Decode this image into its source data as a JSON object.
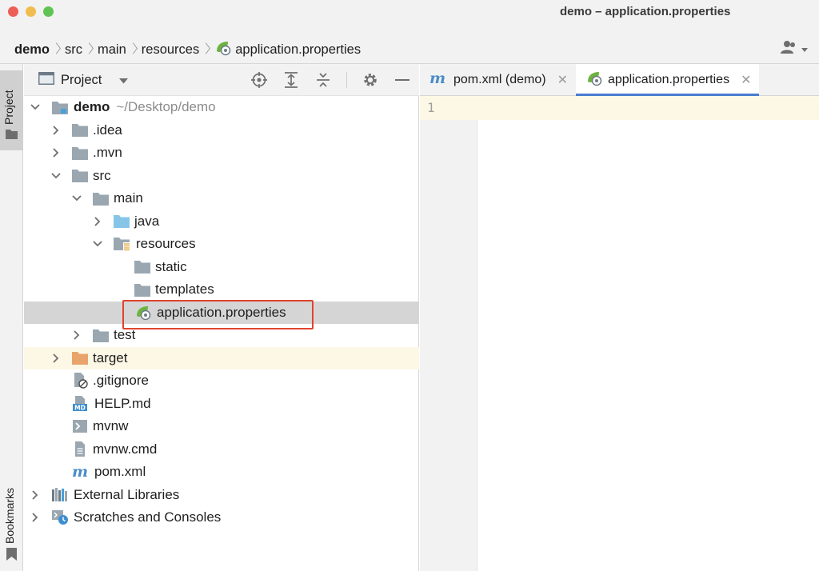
{
  "window": {
    "title": "demo – application.properties"
  },
  "breadcrumbs": [
    {
      "label": "demo",
      "bold": true
    },
    {
      "label": "src"
    },
    {
      "label": "main"
    },
    {
      "label": "resources"
    },
    {
      "label": "application.properties",
      "icon": "spring-properties-icon"
    }
  ],
  "project_panel": {
    "title": "Project",
    "tools": [
      "locate-icon",
      "expand-all-icon",
      "collapse-all-icon",
      "gear-icon",
      "hide-icon"
    ]
  },
  "tree": [
    {
      "label": "demo",
      "hint": "~/Desktop/demo",
      "depth": 0,
      "state": "expanded",
      "icon": "module-folder-icon",
      "bold": true
    },
    {
      "label": ".idea",
      "depth": 1,
      "state": "collapsed",
      "icon": "folder-icon"
    },
    {
      "label": ".mvn",
      "depth": 1,
      "state": "collapsed",
      "icon": "folder-icon"
    },
    {
      "label": "src",
      "depth": 1,
      "state": "expanded",
      "icon": "folder-icon"
    },
    {
      "label": "main",
      "depth": 2,
      "state": "expanded",
      "icon": "folder-icon"
    },
    {
      "label": "java",
      "depth": 3,
      "state": "collapsed",
      "icon": "source-folder-icon"
    },
    {
      "label": "resources",
      "depth": 3,
      "state": "expanded",
      "icon": "resources-folder-icon"
    },
    {
      "label": "static",
      "depth": 4,
      "state": "none",
      "icon": "folder-icon"
    },
    {
      "label": "templates",
      "depth": 4,
      "state": "none",
      "icon": "folder-icon"
    },
    {
      "label": "application.properties",
      "depth": 4,
      "state": "none",
      "icon": "spring-properties-icon",
      "selected": true,
      "highlighted": true
    },
    {
      "label": "test",
      "depth": 2,
      "state": "collapsed",
      "icon": "folder-icon"
    },
    {
      "label": "target",
      "depth": 1,
      "state": "collapsed",
      "icon": "excluded-folder-icon",
      "excluded": true
    },
    {
      "label": ".gitignore",
      "depth": 1,
      "state": "none",
      "icon": "ignore-file-icon"
    },
    {
      "label": "HELP.md",
      "depth": 1,
      "state": "none",
      "icon": "markdown-file-icon"
    },
    {
      "label": "mvnw",
      "depth": 1,
      "state": "none",
      "icon": "shell-script-icon"
    },
    {
      "label": "mvnw.cmd",
      "depth": 1,
      "state": "none",
      "icon": "text-file-icon"
    },
    {
      "label": "pom.xml",
      "depth": 1,
      "state": "none",
      "icon": "maven-icon"
    },
    {
      "label": "External Libraries",
      "depth": 0,
      "state": "collapsed",
      "icon": "libraries-icon"
    },
    {
      "label": "Scratches and Consoles",
      "depth": 0,
      "state": "collapsed",
      "icon": "scratches-icon"
    }
  ],
  "tabs": [
    {
      "label": "pom.xml (demo)",
      "icon": "maven-icon",
      "active": false
    },
    {
      "label": "application.properties",
      "icon": "spring-properties-icon",
      "active": true
    }
  ],
  "editor": {
    "line_numbers": [
      "1"
    ]
  },
  "side_stripe": {
    "top_label": "Project",
    "bottom_label": "Bookmarks"
  },
  "colors": {
    "selection": "#d5d5d5",
    "highlight_box": "#e0432e",
    "active_tab_underline": "#4a7bd0",
    "excluded_row": "#fdf8e6",
    "folder": "#9aa7b0",
    "source_folder": "#87c5e8",
    "excluded_folder": "#e8a46a",
    "spring_green": "#6db33f"
  }
}
